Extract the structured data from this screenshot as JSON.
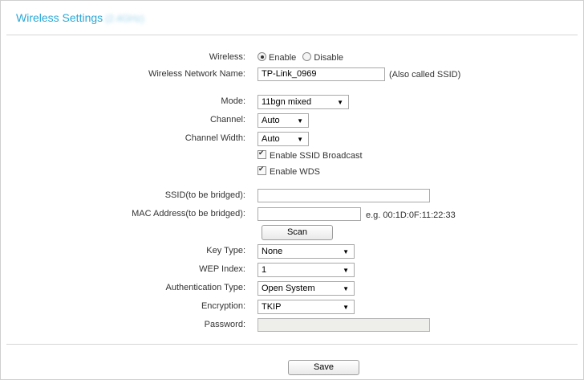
{
  "header": {
    "title": "Wireless Settings",
    "band": "(2.4GHz)"
  },
  "wireless": {
    "label": "Wireless:",
    "enable_label": "Enable",
    "disable_label": "Disable",
    "selected": "Enable"
  },
  "network_name": {
    "label": "Wireless Network Name:",
    "value": "TP-Link_0969",
    "hint": "(Also called SSID)"
  },
  "mode": {
    "label": "Mode:",
    "value": "11bgn mixed"
  },
  "channel": {
    "label": "Channel:",
    "value": "Auto"
  },
  "channel_width": {
    "label": "Channel Width:",
    "value": "Auto"
  },
  "ssid_broadcast": {
    "label": "Enable SSID Broadcast",
    "checked": true
  },
  "wds": {
    "label": "Enable WDS",
    "checked": true
  },
  "ssid_bridged": {
    "label": "SSID(to be bridged):",
    "value": ""
  },
  "mac_bridged": {
    "label": "MAC Address(to be bridged):",
    "value": "",
    "hint": "e.g. 00:1D:0F:11:22:33"
  },
  "scan_button": {
    "label": "Scan"
  },
  "key_type": {
    "label": "Key Type:",
    "value": "None"
  },
  "wep_index": {
    "label": "WEP Index:",
    "value": "1"
  },
  "auth_type": {
    "label": "Authentication Type:",
    "value": "Open System"
  },
  "encryption": {
    "label": "Encryption:",
    "value": "TKIP"
  },
  "password": {
    "label": "Password:",
    "value": ""
  },
  "save_button": {
    "label": "Save"
  },
  "icons": {
    "dropdown": "▼"
  },
  "colors": {
    "title": "#2aa8d8",
    "border": "#cfcfcf"
  }
}
